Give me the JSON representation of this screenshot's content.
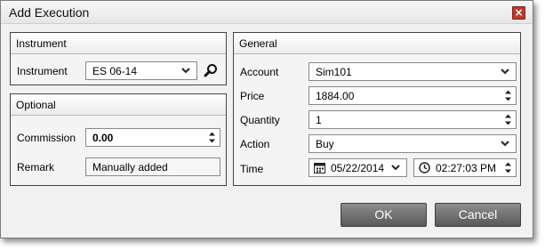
{
  "window": {
    "title": "Add Execution",
    "close_glyph": "×"
  },
  "instrument": {
    "group_title": "Instrument",
    "label": "Instrument",
    "value": "ES 06-14",
    "search_icon": "search-icon"
  },
  "optional": {
    "group_title": "Optional",
    "commission_label": "Commission",
    "commission_value": "0.00",
    "remark_label": "Remark",
    "remark_value": "Manually added"
  },
  "general": {
    "group_title": "General",
    "account_label": "Account",
    "account_value": "Sim101",
    "price_label": "Price",
    "price_value": "1884.00",
    "quantity_label": "Quantity",
    "quantity_value": "1",
    "action_label": "Action",
    "action_value": "Buy",
    "time_label": "Time",
    "date_value": "05/22/2014",
    "time_value": "02:27:03 PM"
  },
  "buttons": {
    "ok": "OK",
    "cancel": "Cancel"
  },
  "colors": {
    "button_top": "#8d8d8d",
    "button_bottom": "#595959",
    "close": "#c0392b"
  }
}
